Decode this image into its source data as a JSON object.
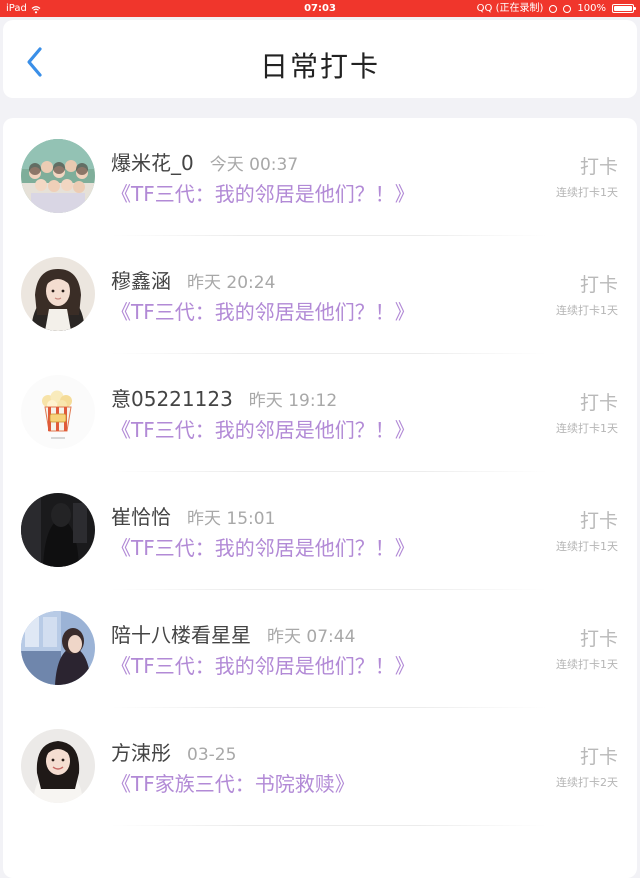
{
  "status_bar": {
    "device": "iPad",
    "time": "07:03",
    "app_status": "QQ (正在录制)",
    "battery": "100%"
  },
  "header": {
    "title": "日常打卡",
    "back_icon": "chevron-left-icon",
    "accent_color": "#3a8fe8"
  },
  "colors": {
    "status_bar_bg": "#f0362c",
    "book_title": "#b28ad6",
    "muted_text": "#a8a8a8"
  },
  "checkins": [
    {
      "username": "爆米花_0",
      "time": "今天 00:37",
      "book": "《TF三代：我的邻居是他们？！》",
      "action": "打卡",
      "streak": "连续打卡1天",
      "avatar": "group-photo-avatar"
    },
    {
      "username": "穆鑫涵",
      "time": "昨天 20:24",
      "book": "《TF三代：我的邻居是他们？！》",
      "action": "打卡",
      "streak": "连续打卡1天",
      "avatar": "girl-portrait-avatar"
    },
    {
      "username": "意05221123",
      "time": "昨天 19:12",
      "book": "《TF三代：我的邻居是他们？！》",
      "action": "打卡",
      "streak": "连续打卡1天",
      "avatar": "popcorn-avatar"
    },
    {
      "username": "崔恰恰",
      "time": "昨天 15:01",
      "book": "《TF三代：我的邻居是他们？！》",
      "action": "打卡",
      "streak": "连续打卡1天",
      "avatar": "dark-portrait-avatar"
    },
    {
      "username": "陪十八楼看星星",
      "time": "昨天 07:44",
      "book": "《TF三代：我的邻居是他们？！》",
      "action": "打卡",
      "streak": "连续打卡1天",
      "avatar": "girl-window-avatar"
    },
    {
      "username": "方涑彤",
      "time": "03-25",
      "book": "《TF家族三代：书院救赎》",
      "action": "打卡",
      "streak": "连续打卡2天",
      "avatar": "smiling-girl-avatar"
    }
  ]
}
